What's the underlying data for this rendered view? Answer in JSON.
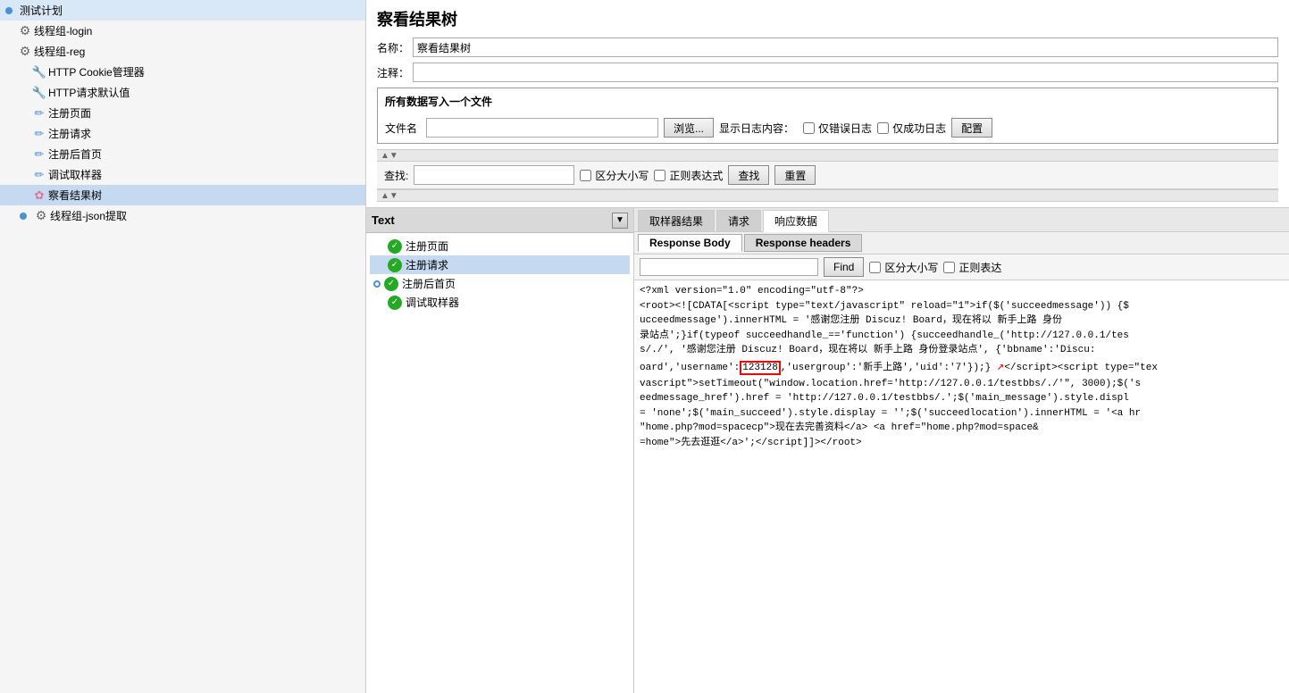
{
  "left_tree": {
    "items": [
      {
        "id": "test-plan",
        "label": "测试计划",
        "indent": 0,
        "icon": "none",
        "dot": true
      },
      {
        "id": "thread-login",
        "label": "线程组-login",
        "indent": 1,
        "icon": "gear"
      },
      {
        "id": "thread-reg",
        "label": "线程组-reg",
        "indent": 1,
        "icon": "gear"
      },
      {
        "id": "http-cookie",
        "label": "HTTP Cookie管理器",
        "indent": 2,
        "icon": "tool"
      },
      {
        "id": "http-defaults",
        "label": "HTTP请求默认值",
        "indent": 2,
        "icon": "tool"
      },
      {
        "id": "reg-page",
        "label": "注册页面",
        "indent": 2,
        "icon": "pencil"
      },
      {
        "id": "reg-request",
        "label": "注册请求",
        "indent": 2,
        "icon": "pencil"
      },
      {
        "id": "reg-home",
        "label": "注册后首页",
        "indent": 2,
        "icon": "pencil"
      },
      {
        "id": "debug-sampler",
        "label": "调试取样器",
        "indent": 2,
        "icon": "pencil"
      },
      {
        "id": "view-results",
        "label": "察看结果树",
        "indent": 2,
        "icon": "flower",
        "selected": true
      },
      {
        "id": "thread-json",
        "label": "线程组-json提取",
        "indent": 1,
        "icon": "gear",
        "dot": true
      }
    ]
  },
  "right_panel": {
    "title": "察看结果树",
    "name_label": "名称：",
    "name_value": "察看结果树",
    "comment_label": "注释：",
    "file_section_title": "所有数据写入一个文件",
    "file_name_label": "文件名",
    "browse_btn": "浏览...",
    "show_log_label": "显示日志内容：",
    "only_error_label": "仅错误日志",
    "only_success_label": "仅成功日志",
    "config_btn": "配置",
    "find_label": "查找:",
    "case_sensitive_label": "区分大小写",
    "regex_label": "正则表达式",
    "find_btn": "查找",
    "reset_btn": "重置"
  },
  "bottom": {
    "tree_header": "Text",
    "dropdown_symbol": "▼",
    "results": [
      {
        "label": "注册页面",
        "check": true,
        "indent": false
      },
      {
        "label": "注册请求",
        "check": true,
        "indent": false,
        "selected": true
      },
      {
        "label": "注册后首页",
        "check": true,
        "indent": false,
        "dot": true
      },
      {
        "label": "调试取样器",
        "check": true,
        "indent": false
      }
    ],
    "tabs": [
      {
        "id": "sampler-result",
        "label": "取样器结果",
        "active": false
      },
      {
        "id": "request",
        "label": "请求",
        "active": false
      },
      {
        "id": "response-data",
        "label": "响应数据",
        "active": true
      }
    ],
    "sub_tabs": [
      {
        "id": "response-body",
        "label": "Response Body",
        "active": true
      },
      {
        "id": "response-headers",
        "label": "Response headers",
        "active": false
      }
    ],
    "find_placeholder": "",
    "find_btn": "Find",
    "case_label": "区分大小写",
    "regex_label": "正则表达",
    "content": "<?xml version=\"1.0\" encoding=\"utf-8\"?>\n<root><![CDATA[<script type=\"text/javascript\" reload=\"1\">if($('succeedmessage')) {$\nucceedmessage').innerHTML = '感谢您注册 Discuz! Board，现在将以 新手上路 身份\n录站点';}if(typeof succeedhandle_=='function') {succeedhandle_('http://127.0.0.1/tes\ns/./', '感谢您注册 Discuz! Board，现在将以 新手上路 身份登录站点', {'bbname':'Discu:\noard','username':'123128','usergroup':'新手上路','uid':'7'});}\\x3c/script><script type=\"tex\nvascript\">setTimeout(\"window.location.href='http://127.0.0.1/testbbs/./';\", 3000);$('s\needmessage_href').href = 'http://127.0.0.1/testbbs/.';$('main_message').style.displ\n= 'none';$('main_succeed').style.display = '';$('succeedlocation').innerHTML = '<a hr\n\"home.php?mod=spacecp\">现在去完善资料</a> <a href=\"home.php?mod=space&\n=home\">先去逛逛</a>';</script]]></root>",
    "highlighted_word": "123128"
  }
}
